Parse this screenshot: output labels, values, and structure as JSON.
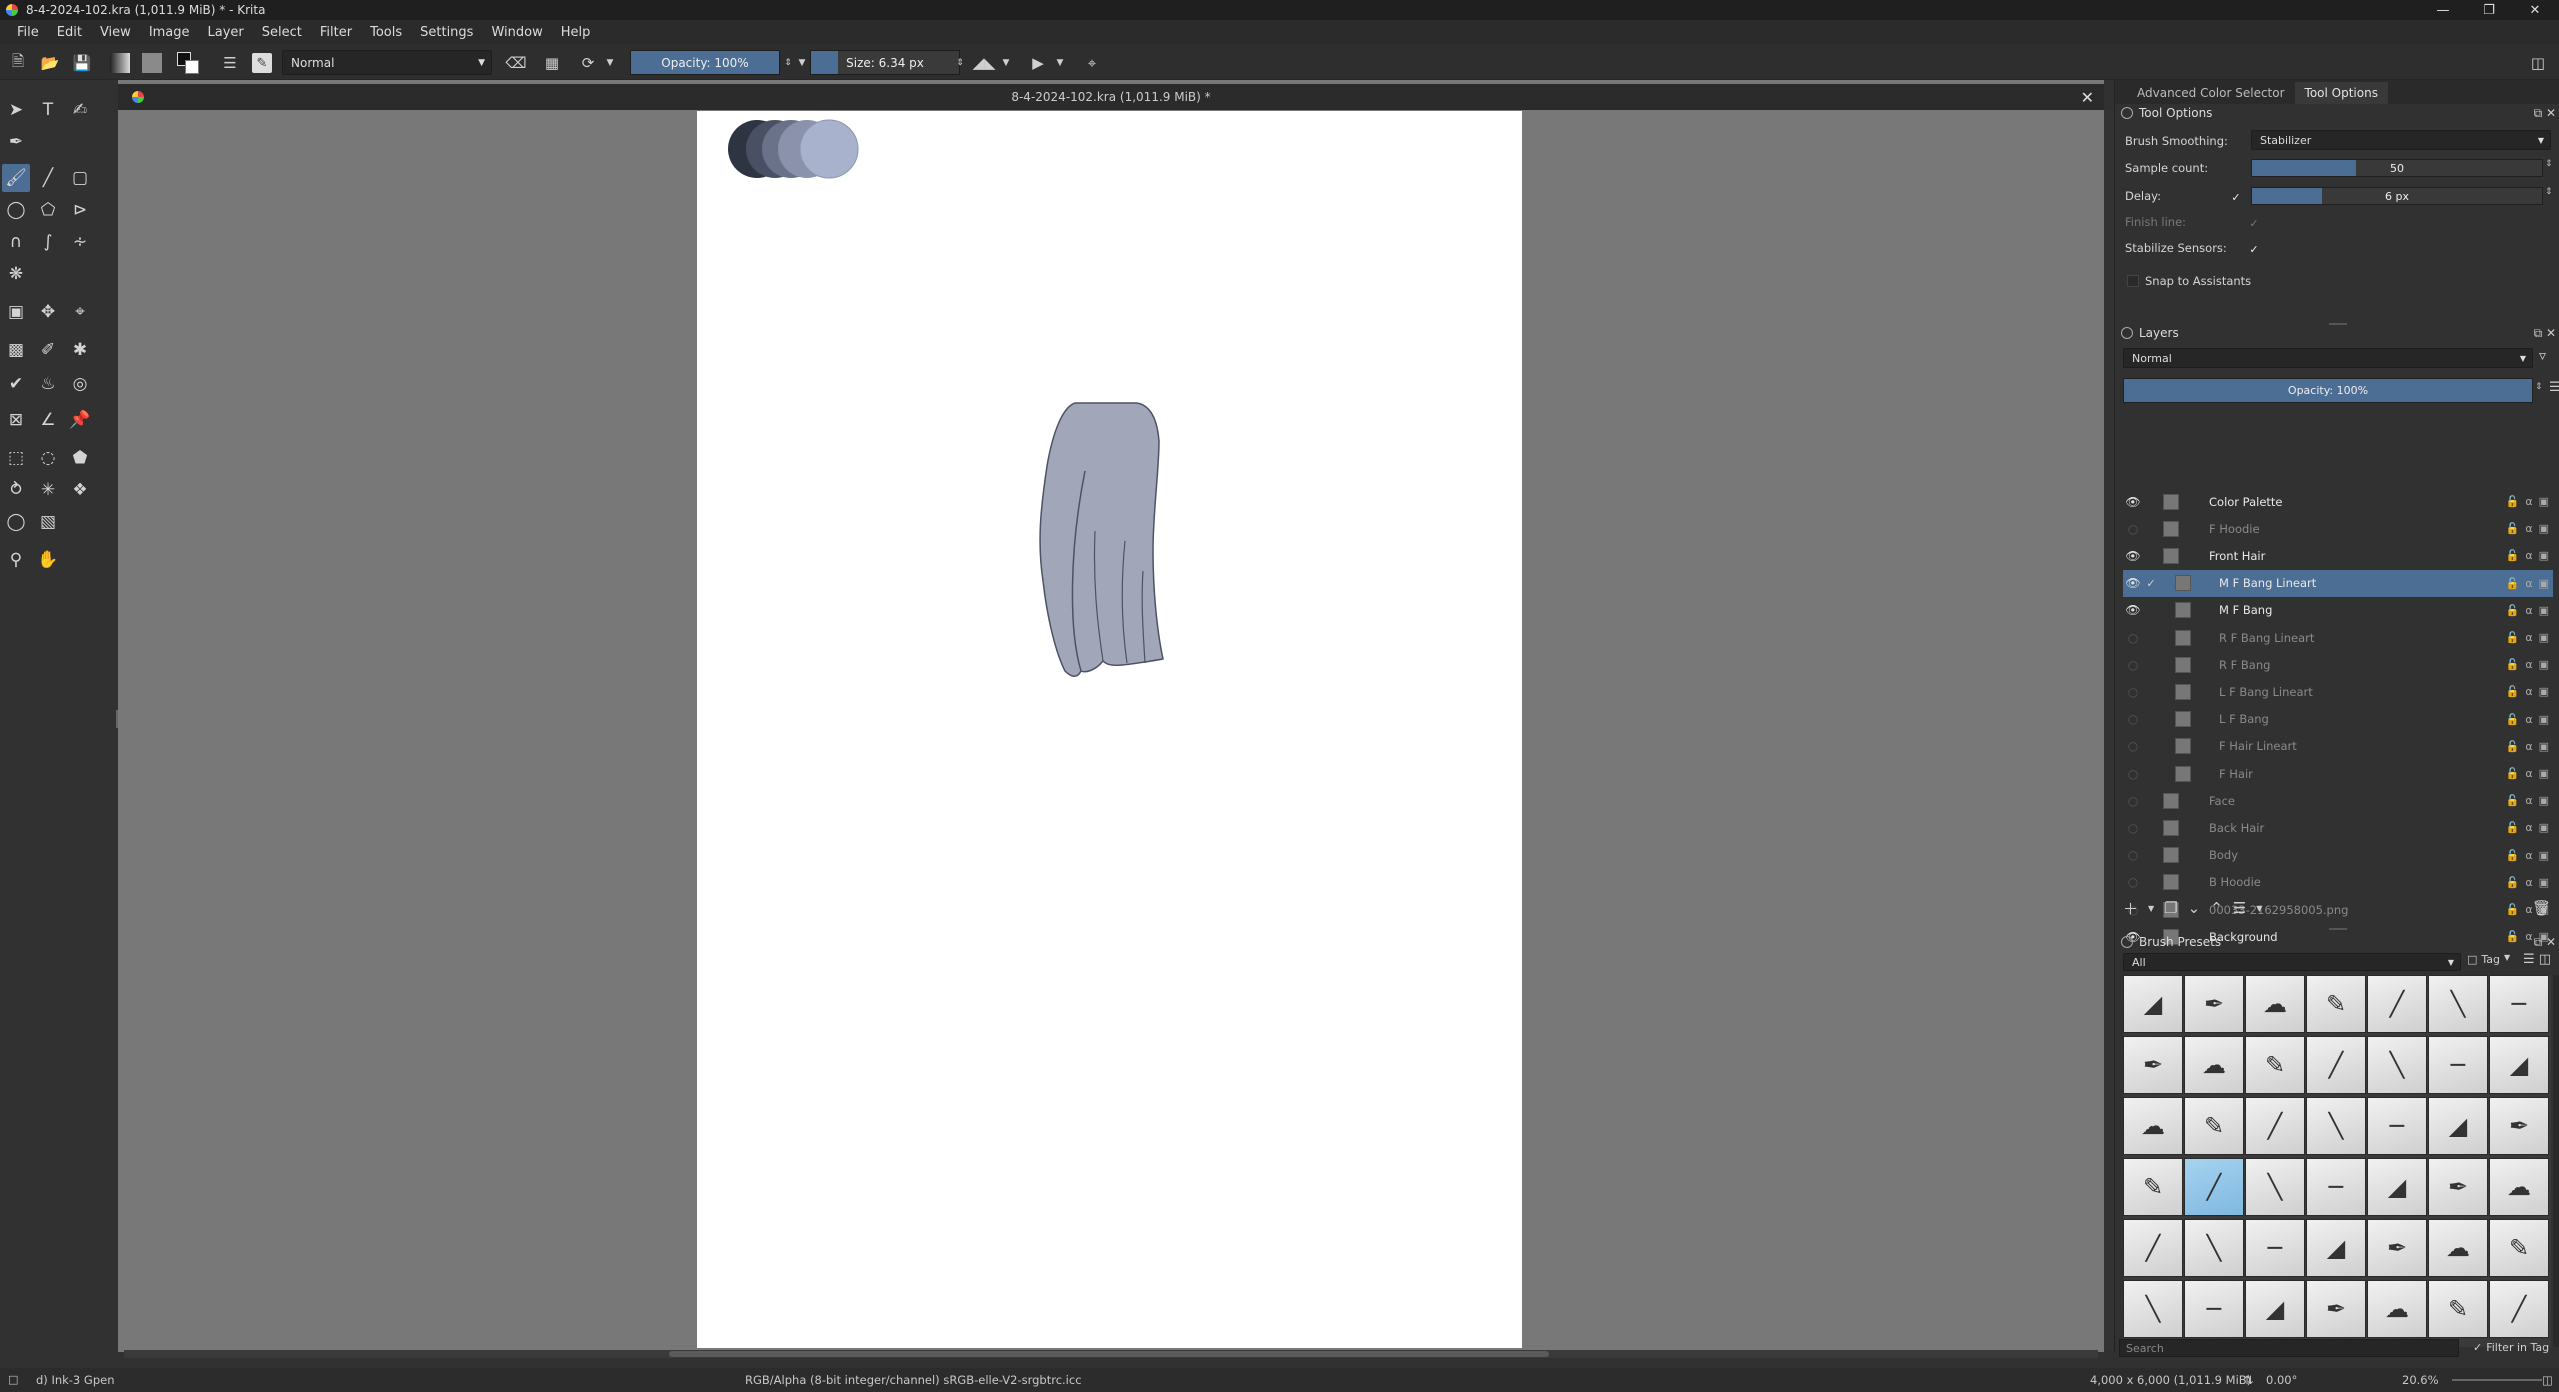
{
  "window": {
    "title": "8-4-2024-102.kra (1,011.9 MiB) * - Krita"
  },
  "menu": [
    "File",
    "Edit",
    "View",
    "Image",
    "Layer",
    "Select",
    "Filter",
    "Tools",
    "Settings",
    "Window",
    "Help"
  ],
  "toolbar": {
    "blend_mode": "Normal",
    "opacity_label": "Opacity: 100%",
    "opacity_value": 100,
    "size_label": "Size: 6.34 px"
  },
  "document": {
    "tab_title": "8-4-2024-102.kra (1,011.9 MiB) *"
  },
  "docker_tabs": [
    "Advanced Color Selector",
    "Tool Options"
  ],
  "tool_options": {
    "header": "Tool Options",
    "brush_smoothing_label": "Brush Smoothing:",
    "brush_smoothing_value": "Stabilizer",
    "sample_count_label": "Sample count:",
    "sample_count_value": "50",
    "delay_label": "Delay:",
    "delay_value": "6 px",
    "finish_line_label": "Finish line:",
    "stabilize_sensors_label": "Stabilize Sensors:",
    "snap_label": "Snap to Assistants"
  },
  "layers": {
    "header": "Layers",
    "blend_mode": "Normal",
    "opacity_label": "Opacity:  100%",
    "items": [
      {
        "name": "Color Palette",
        "visible": true,
        "indent": 0,
        "selected": false
      },
      {
        "name": "F Hoodie",
        "visible": false,
        "indent": 0,
        "selected": false
      },
      {
        "name": "Front Hair",
        "visible": true,
        "indent": 0,
        "selected": false
      },
      {
        "name": "M F Bang Lineart",
        "visible": true,
        "indent": 1,
        "selected": true
      },
      {
        "name": "M F Bang",
        "visible": true,
        "indent": 1,
        "selected": false
      },
      {
        "name": "R F Bang Lineart",
        "visible": false,
        "indent": 1,
        "selected": false
      },
      {
        "name": "R F Bang",
        "visible": false,
        "indent": 1,
        "selected": false
      },
      {
        "name": "L F Bang Lineart",
        "visible": false,
        "indent": 1,
        "selected": false
      },
      {
        "name": "L F Bang",
        "visible": false,
        "indent": 1,
        "selected": false
      },
      {
        "name": "F Hair Lineart",
        "visible": false,
        "indent": 1,
        "selected": false
      },
      {
        "name": "F Hair",
        "visible": false,
        "indent": 1,
        "selected": false
      },
      {
        "name": "Face",
        "visible": false,
        "indent": 0,
        "selected": false
      },
      {
        "name": "Back Hair",
        "visible": false,
        "indent": 0,
        "selected": false
      },
      {
        "name": "Body",
        "visible": false,
        "indent": 0,
        "selected": false
      },
      {
        "name": "B Hoodie",
        "visible": false,
        "indent": 0,
        "selected": false
      },
      {
        "name": "00033-2162958005.png",
        "visible": false,
        "indent": 0,
        "selected": false
      },
      {
        "name": "Background",
        "visible": true,
        "indent": 0,
        "selected": false
      }
    ]
  },
  "brush_presets": {
    "header": "Brush Presets",
    "filter": "All",
    "tag_label": "Tag",
    "search_placeholder": "Search",
    "filter_in_tag": "Filter in Tag"
  },
  "statusbar": {
    "brush": "d) Ink-3 Gpen",
    "color_info": "RGB/Alpha (8-bit integer/channel)  sRGB-elle-V2-srgbtrc.icc",
    "dimensions": "4,000 x 6,000 (1,011.9 MiB)",
    "rotation": "0.00°",
    "zoom": "20.6%"
  },
  "colors": {
    "accent": "#4d6e94",
    "canvas_bg": "#787878",
    "hair_fill": "#a1a6b8",
    "swatches": [
      "#2e3442",
      "#4a5063",
      "#6a7289",
      "#8a93ab",
      "#a9b2cd"
    ]
  }
}
